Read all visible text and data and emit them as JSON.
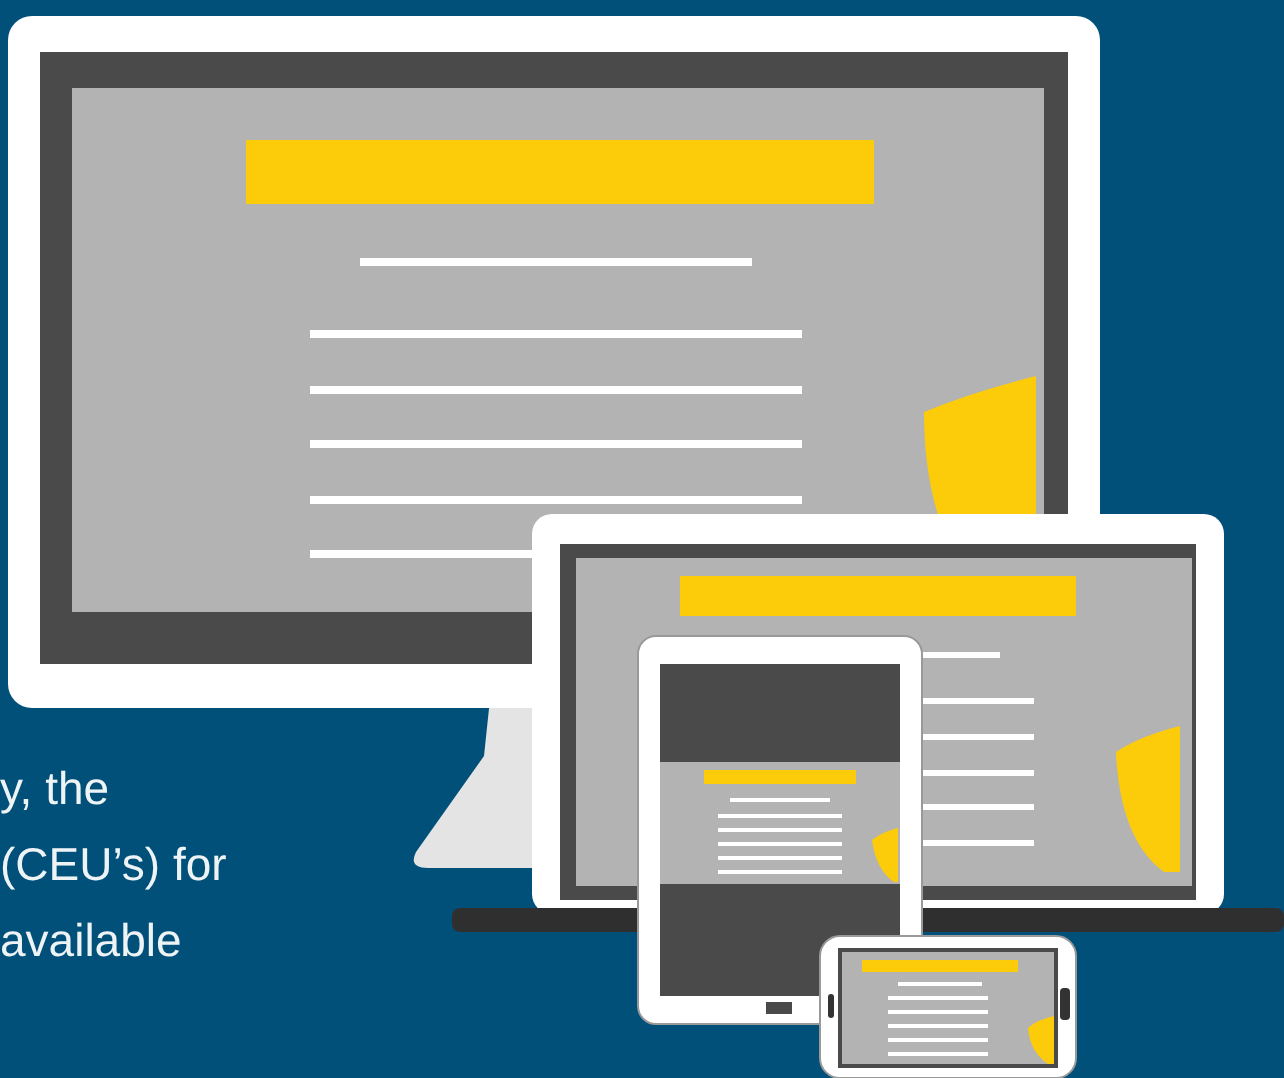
{
  "hero": {
    "text_lines": [
      "y, the",
      "(CEU’s) for",
      "available"
    ]
  }
}
